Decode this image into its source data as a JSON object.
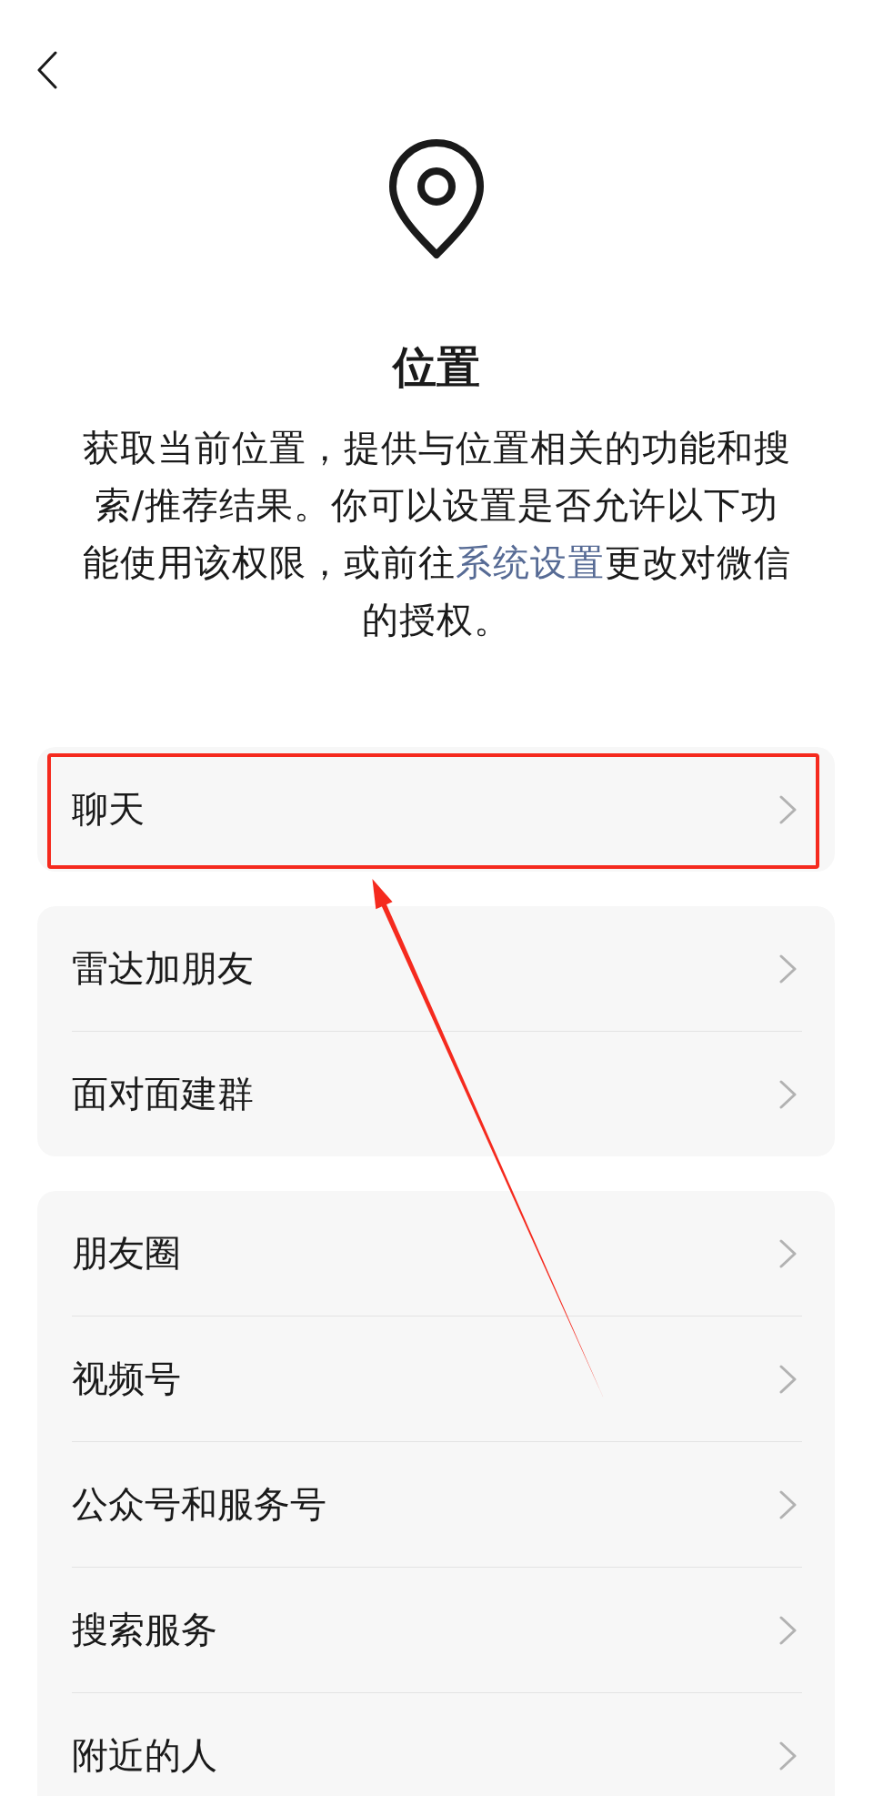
{
  "title": "位置",
  "description": {
    "before": "获取当前位置，提供与位置相关的功能和搜索/推荐结果。你可以设置是否允许以下功能使用该权限，或前往",
    "link": "系统设置",
    "after": "更改对微信的授权。"
  },
  "groups": [
    {
      "items": [
        {
          "label": "聊天",
          "highlighted": true
        }
      ]
    },
    {
      "items": [
        {
          "label": "雷达加朋友",
          "highlighted": false
        },
        {
          "label": "面对面建群",
          "highlighted": false
        }
      ]
    },
    {
      "items": [
        {
          "label": "朋友圈",
          "highlighted": false
        },
        {
          "label": "视频号",
          "highlighted": false
        },
        {
          "label": "公众号和服务号",
          "highlighted": false
        },
        {
          "label": "搜索服务",
          "highlighted": false
        },
        {
          "label": "附近的人",
          "highlighted": false
        }
      ]
    }
  ]
}
